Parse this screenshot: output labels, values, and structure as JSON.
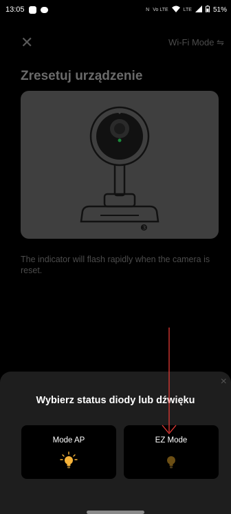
{
  "status_bar": {
    "time": "13:05",
    "indicators": "N  ᵛᵒ⁽ ˡᵗᵉ LTE",
    "battery": "51%"
  },
  "header": {
    "close_icon": "close-icon",
    "mode_label": "Wi-Fi Mode ⇋"
  },
  "page": {
    "title": "Zresetuj urządzenie",
    "step_badge": "❸",
    "description": "The indicator will flash rapidly when the camera is reset."
  },
  "sheet": {
    "title": "Wybierz status diody lub dźwięku",
    "close": "×",
    "options": [
      {
        "label": "Mode AP",
        "icon": "bulb-lit-icon",
        "bulb_color": "#F7B43A"
      },
      {
        "label": "EZ Mode",
        "icon": "bulb-dim-icon",
        "bulb_color": "#6B4E14"
      }
    ]
  },
  "colors": {
    "arrow": "#E53935",
    "sheet_bg": "#1E1E1E",
    "option_bg": "#000000"
  }
}
